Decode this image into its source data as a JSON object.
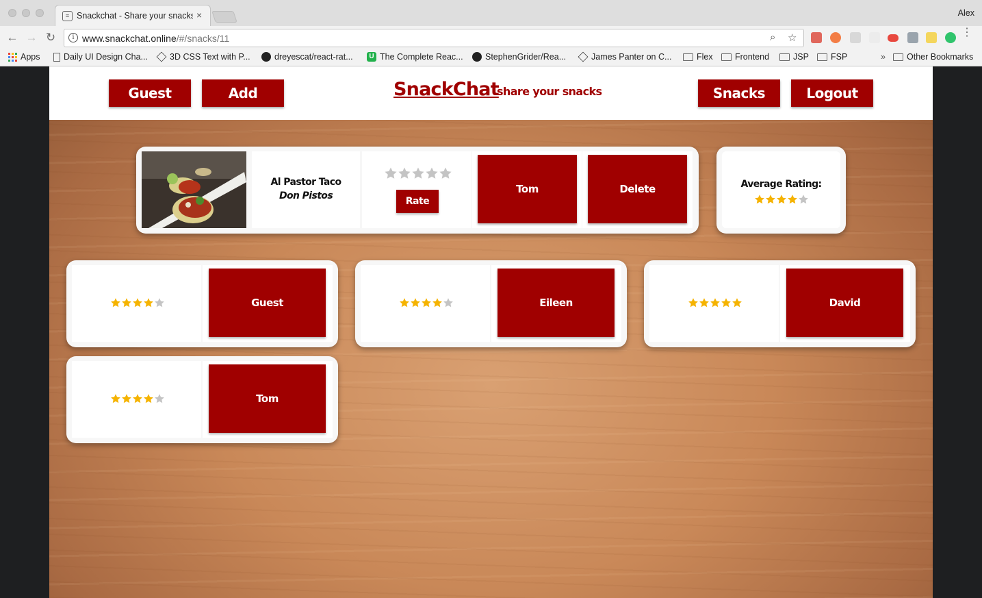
{
  "browser": {
    "tab_title": "Snackchat - Share your snacks",
    "tab_close": "×",
    "profile_name": "Alex",
    "url_host": "www.snackchat.online",
    "url_path": "/#/snacks/11",
    "bookmarks": [
      "Apps",
      "Daily UI Design Cha...",
      "3D CSS Text with P...",
      "dreyescat/react-rat...",
      "The Complete Reac...",
      "StephenGrider/Rea...",
      "James Panter on C...",
      "Flex",
      "Frontend",
      "JSP",
      "FSP"
    ],
    "bookmarks_overflow": "»",
    "other_bookmarks": "Other Bookmarks"
  },
  "header": {
    "brand": "SnackChat",
    "tagline": "share your snacks",
    "guest_label": "Guest",
    "add_label": "Add",
    "snacks_label": "Snacks",
    "logout_label": "Logout"
  },
  "snack": {
    "name": "Al Pastor Taco",
    "place": "Don Pistos",
    "rate_label": "Rate",
    "user_rating": 0,
    "owner_label": "Tom",
    "delete_label": "Delete"
  },
  "average": {
    "label": "Average Rating:",
    "rating": 4
  },
  "reviews": [
    {
      "rating": 4,
      "user": "Guest"
    },
    {
      "rating": 4,
      "user": "Eileen"
    },
    {
      "rating": 5,
      "user": "David"
    },
    {
      "rating": 4,
      "user": "Tom"
    }
  ],
  "colors": {
    "accent": "#a00000",
    "star_filled": "#f5b301",
    "star_empty": "#c4c4c4"
  },
  "icons": {
    "star": "star-icon",
    "taco_photo": "taco-photo"
  }
}
